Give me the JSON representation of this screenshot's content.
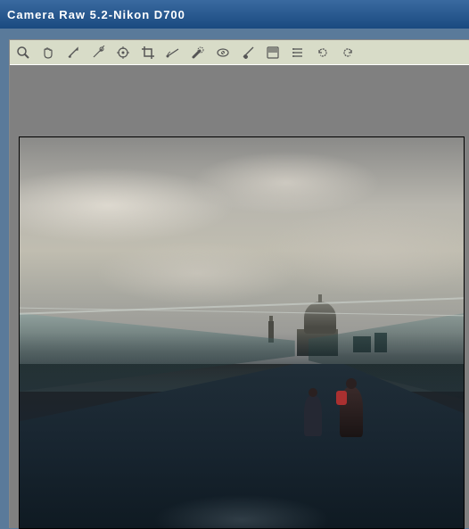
{
  "title_bar": {
    "app": "Camera Raw 5.2",
    "separator": " - ",
    "device": " Nikon D700"
  },
  "tools": [
    {
      "name": "zoom-icon"
    },
    {
      "name": "hand-icon"
    },
    {
      "name": "white-balance-icon"
    },
    {
      "name": "color-sampler-icon"
    },
    {
      "name": "targeted-adjust-icon"
    },
    {
      "name": "crop-icon"
    },
    {
      "name": "straighten-icon"
    },
    {
      "name": "spot-removal-icon"
    },
    {
      "name": "redeye-icon"
    },
    {
      "name": "adjustment-brush-icon"
    },
    {
      "name": "graduated-filter-icon"
    },
    {
      "name": "preferences-icon"
    },
    {
      "name": "rotate-ccw-icon"
    },
    {
      "name": "rotate-cw-icon"
    }
  ]
}
